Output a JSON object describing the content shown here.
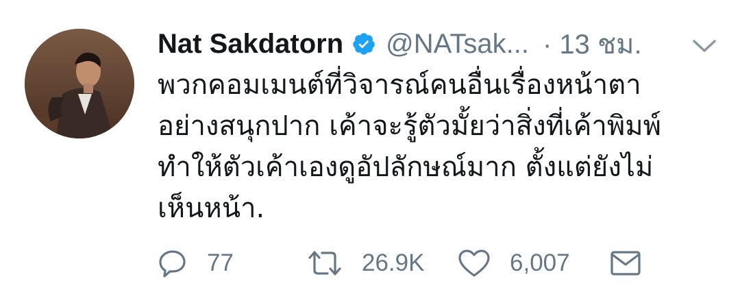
{
  "tweet": {
    "author_name": "Nat Sakdatorn",
    "handle": "@NATsak...",
    "time": "· 13 ชม.",
    "text_lines": [
      "พวกคอมเมนต์ที่วิจารณ์คนอื่นเรื่องหน้าตา",
      "อย่างสนุกปาก เค้าจะรู้ตัวมั้ยว่าสิ่งที่เค้าพิมพ์",
      "ทำให้ตัวเค้าเองดูอัปลักษณ์มาก ตั้งแต่ยังไม่",
      "เห็นหน้า."
    ],
    "replies": "77",
    "retweets": "26.9K",
    "likes": "6,007"
  },
  "icons": {
    "verified": "verified-badge-icon",
    "menu": "chevron-down-icon",
    "reply": "reply-icon",
    "retweet": "retweet-icon",
    "like": "heart-icon",
    "share": "envelope-icon"
  },
  "colors": {
    "verified": "#1da1f2",
    "icon_gray": "#657786",
    "text": "#14171a"
  }
}
